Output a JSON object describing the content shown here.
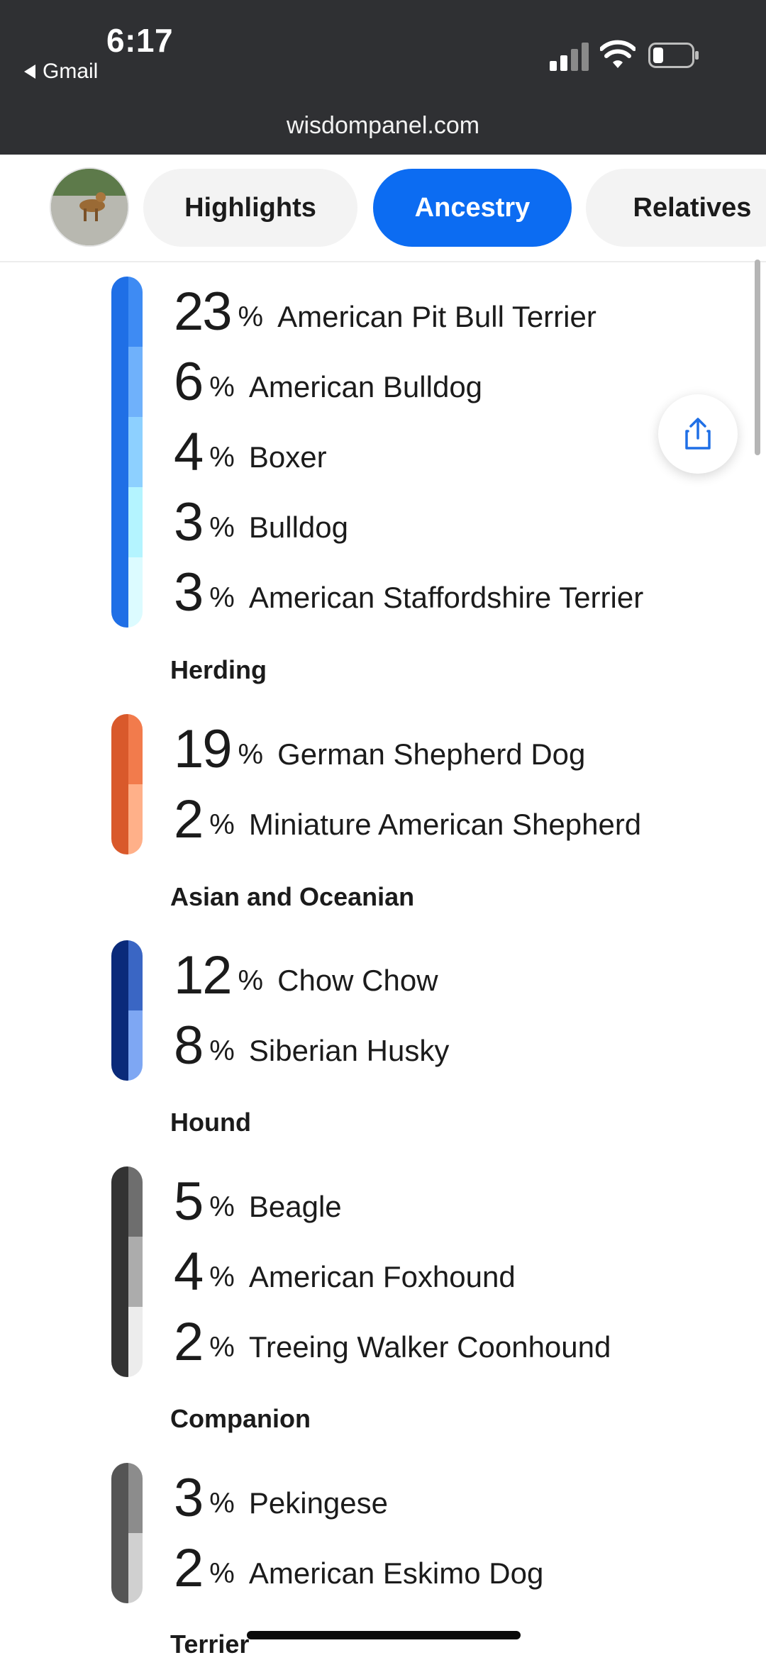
{
  "status_bar": {
    "time": "6:17",
    "back_app": "Gmail",
    "icons": [
      "signal-icon",
      "wifi-icon",
      "battery-icon"
    ]
  },
  "browser": {
    "url": "wisdompanel.com"
  },
  "tabs": [
    {
      "label": "Highlights",
      "active": false
    },
    {
      "label": "Ancestry",
      "active": true
    },
    {
      "label": "Relatives",
      "active": false
    }
  ],
  "colors": {
    "accent": "#0c6cf2",
    "bar_blue": "#1f6fe6",
    "bar_orange": "#d9592b",
    "bar_navy": "#0a2a7a",
    "bar_gray": "#3a3a3a"
  },
  "groups": [
    {
      "category": "",
      "breeds": [
        {
          "percent": "23",
          "sign": "%",
          "name": "American Pit Bull Terrier"
        },
        {
          "percent": "6",
          "sign": "%",
          "name": "American Bulldog"
        },
        {
          "percent": "4",
          "sign": "%",
          "name": "Boxer"
        },
        {
          "percent": "3",
          "sign": "%",
          "name": "Bulldog"
        },
        {
          "percent": "3",
          "sign": "%",
          "name": "American Staffordshire Terrier"
        }
      ]
    },
    {
      "category": "Herding",
      "breeds": [
        {
          "percent": "19",
          "sign": "%",
          "name": "German Shepherd Dog"
        },
        {
          "percent": "2",
          "sign": "%",
          "name": "Miniature American Shepherd"
        }
      ]
    },
    {
      "category": "Asian and Oceanian",
      "breeds": [
        {
          "percent": "12",
          "sign": "%",
          "name": "Chow Chow"
        },
        {
          "percent": "8",
          "sign": "%",
          "name": "Siberian Husky"
        }
      ]
    },
    {
      "category": "Hound",
      "breeds": [
        {
          "percent": "5",
          "sign": "%",
          "name": "Beagle"
        },
        {
          "percent": "4",
          "sign": "%",
          "name": "American Foxhound"
        },
        {
          "percent": "2",
          "sign": "%",
          "name": "Treeing Walker Coonhound"
        }
      ]
    },
    {
      "category": "Companion",
      "breeds": [
        {
          "percent": "3",
          "sign": "%",
          "name": "Pekingese"
        },
        {
          "percent": "2",
          "sign": "%",
          "name": "American Eskimo Dog"
        }
      ]
    },
    {
      "category": "Terrier",
      "breeds": []
    }
  ],
  "share_icon": "share-icon"
}
